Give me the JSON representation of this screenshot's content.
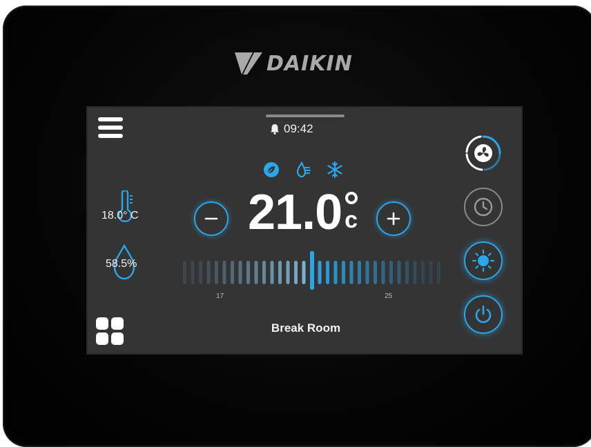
{
  "brand": {
    "name": "DAIKIN",
    "color": "#a9a9a9"
  },
  "status_bar": {
    "alarm_icon": "bell-icon",
    "time": "09:42"
  },
  "modes": {
    "items": [
      "eco-leaf-icon",
      "humidity-icon",
      "snowflake-icon"
    ]
  },
  "room_sensors": {
    "temperature": "18.0° C",
    "humidity": "58.5%"
  },
  "setpoint": {
    "value": "21.0",
    "unit": "c",
    "decrease_icon": "minus-icon",
    "increase_icon": "plus-icon"
  },
  "scale": {
    "min_label": "17",
    "max_label": "25"
  },
  "room": {
    "name": "Break Room"
  },
  "side_controls": {
    "fan": "fan-icon",
    "schedule": "clock-icon",
    "mode": "sun-icon",
    "power": "power-icon"
  },
  "colors": {
    "accent": "#2aa6ea",
    "screen_bg": "#343434",
    "inactive": "#8a8a8a"
  }
}
